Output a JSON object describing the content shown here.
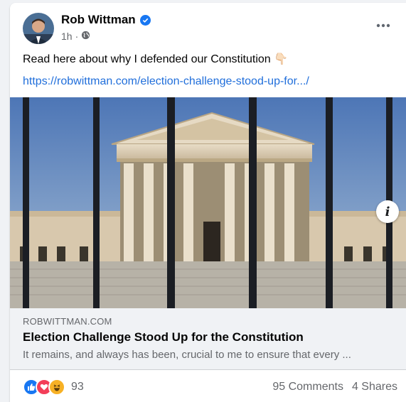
{
  "post": {
    "author": "Rob Wittman",
    "time": "1h",
    "privacy_icon": "globe-icon",
    "text": "Read here about why I defended our Constitution",
    "text_emoji": "👇🏻",
    "link": "https://robwittman.com/election-challenge-stood-up-for.../"
  },
  "link_preview": {
    "domain": "ROBWITTMAN.COM",
    "title": "Election Challenge Stood Up for the Constitution",
    "description": "It remains, and always has been, crucial to me to ensure that every ..."
  },
  "footer": {
    "reaction_icons": [
      "like-icon",
      "love-icon",
      "haha-icon"
    ],
    "reaction_count": "93",
    "comments": "95 Comments",
    "shares": "4 Shares"
  },
  "colors": {
    "accent": "#1877f2",
    "link": "#216fdb",
    "secondary_text": "#65676b",
    "card_bg": "#ffffff",
    "preview_bg": "#f0f2f5"
  }
}
